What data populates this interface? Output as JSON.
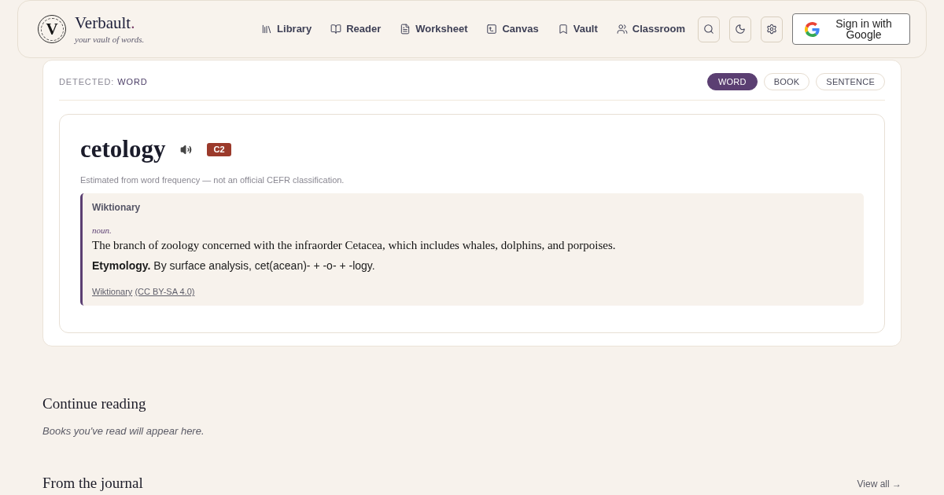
{
  "header": {
    "logo_letter": "V",
    "brand_name": "Verbault",
    "brand_mark": ".",
    "tagline": "your vault of words.",
    "nav": [
      {
        "label": "Library"
      },
      {
        "label": "Reader"
      },
      {
        "label": "Worksheet"
      },
      {
        "label": "Canvas"
      },
      {
        "label": "Vault"
      },
      {
        "label": "Classroom"
      }
    ],
    "sign_in": {
      "label": "Sign in with Google"
    }
  },
  "detector": {
    "label": "DETECTED:",
    "value": "WORD",
    "modes": [
      {
        "label": "WORD",
        "selected": true
      },
      {
        "label": "BOOK",
        "selected": false
      },
      {
        "label": "SENTENCE",
        "selected": false
      }
    ]
  },
  "entry": {
    "word": "cetology",
    "level_badge": "C2",
    "note": "Estimated from word frequency — not an official CEFR classification.",
    "source": {
      "title": "Wiktionary",
      "part_of_speech": "noun.",
      "definition": "The branch of zoology concerned with the infraorder Cetacea, which includes whales, dolphins, and porpoises.",
      "etymology": "**Etymology.** By surface analysis, cet(acean)- + -o- + -logy.",
      "attribution": {
        "source_link": "Wiktionary",
        "license_link": "(CC BY-SA 4.0)"
      }
    }
  },
  "continue_reading": {
    "title": "Continue reading",
    "empty_message": "Books you've read will appear here."
  },
  "journal": {
    "title": "From the journal",
    "view_all": "View all →"
  }
}
